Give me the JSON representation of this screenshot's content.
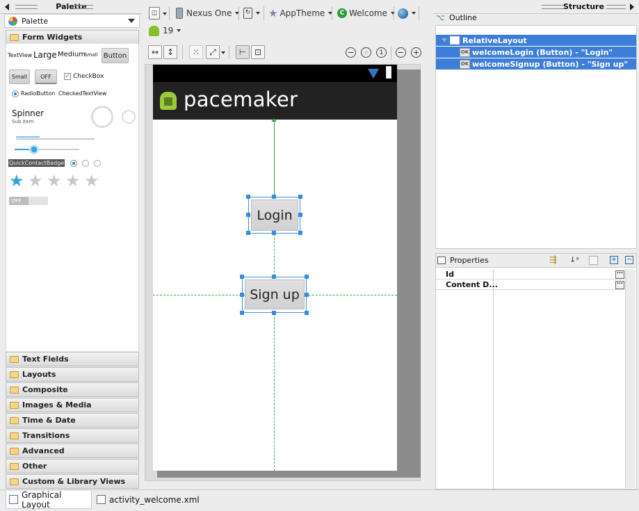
{
  "palette": {
    "title": "Palette",
    "selector": "Palette",
    "open_category": "Form Widgets",
    "widgets": {
      "textview": "TextView",
      "large": "Large",
      "medium": "Medium",
      "small": "Small",
      "button": "Button",
      "small_button": "Small",
      "toggle": "OFF",
      "checkbox": "CheckBox",
      "radio": "RadioButton",
      "checked_textview": "CheckedTextView",
      "spinner": "Spinner",
      "spinner_sub": "Sub Item",
      "quick_contact": "QuickContactBadge",
      "switch_off": "OFF",
      "rating_filled": 1,
      "rating_total": 5
    },
    "categories": [
      "Text Fields",
      "Layouts",
      "Composite",
      "Images & Media",
      "Time & Date",
      "Transitions",
      "Advanced",
      "Other",
      "Custom & Library Views"
    ]
  },
  "toolbar": {
    "device": "Nexus One",
    "theme": "AppTheme",
    "activity": "Welcome",
    "api": "19"
  },
  "device_preview": {
    "app_title": "pacemaker",
    "login_button": "Login",
    "signup_button": "Sign up"
  },
  "structure": {
    "title": "Structure",
    "outline_label": "Outline",
    "tree": [
      {
        "label": "RelativeLayout",
        "icon": "layout-icon"
      },
      {
        "label": "welcomeLogin (Button) - \"Login\"",
        "icon": "button-ok-icon",
        "badge": "OK"
      },
      {
        "label": "welcomeSignup (Button) - \"Sign up\"",
        "icon": "button-ok-icon",
        "badge": "OK"
      }
    ]
  },
  "properties": {
    "title": "Properties",
    "rows": [
      {
        "name": "Id",
        "value": ""
      },
      {
        "name": "Content D...",
        "value": ""
      }
    ]
  },
  "bottom_tabs": [
    "Graphical Layout",
    "activity_welcome.xml"
  ],
  "colors": {
    "selection": "#3d7ed8",
    "guide": "#3ea34b",
    "handle": "#2f8de4",
    "action_bar": "#222222"
  }
}
